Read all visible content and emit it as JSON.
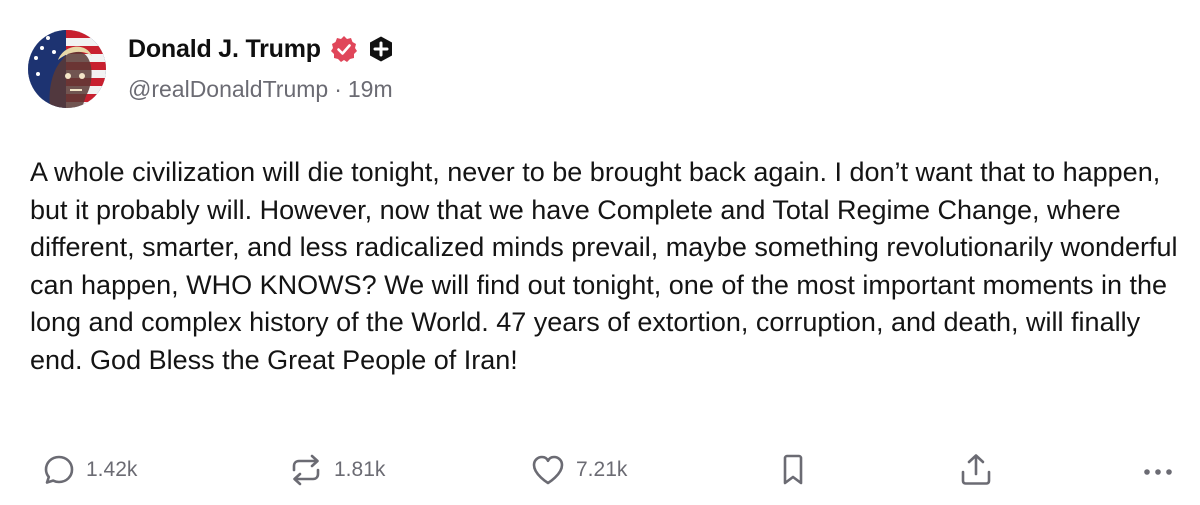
{
  "post": {
    "author": {
      "display_name": "Donald J. Trump",
      "handle": "@realDonaldTrump",
      "separator": "·",
      "time_ago": "19m",
      "verified_icon": "verified-badge-icon",
      "subscriber_icon": "plus-badge-icon"
    },
    "text": "A whole civilization will die tonight, never to be brought back again. I don’t want that to happen, but it probably will. However, now that we have Complete and Total Regime Change, where different, smarter, and less radicalized minds prevail, maybe something revolutionarily wonderful can happen, WHO KNOWS? We will find out tonight, one of the most important moments in the long and complex history of the World. 47 years of extortion, corruption, and death, will finally end. God Bless the Great People of Iran!",
    "actions": {
      "reply": {
        "icon": "reply-icon",
        "count": "1.42k"
      },
      "retruth": {
        "icon": "retruth-icon",
        "count": "1.81k"
      },
      "like": {
        "icon": "heart-icon",
        "count": "7.21k"
      },
      "bookmark": {
        "icon": "bookmark-icon"
      },
      "share": {
        "icon": "share-icon"
      },
      "more": {
        "icon": "more-icon"
      }
    }
  },
  "colors": {
    "text": "#141414",
    "muted": "#6b6b73",
    "verified": "#e0465a",
    "background": "#ffffff"
  }
}
